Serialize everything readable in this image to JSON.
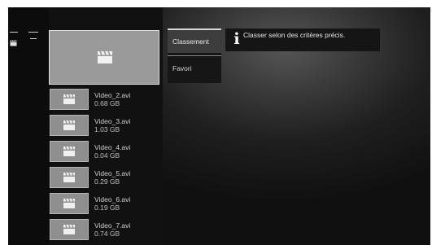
{
  "hero": {
    "icon": "clapperboard-icon"
  },
  "videos": [
    {
      "name": "Video_2.avi",
      "size": "0.68 GB",
      "icon": "clapperboard-icon"
    },
    {
      "name": "Video_3.avi",
      "size": "1.03 GB",
      "icon": "clapperboard-icon"
    },
    {
      "name": "Video_4.avi",
      "size": "0.04 GB",
      "icon": "clapperboard-icon"
    },
    {
      "name": "Video_5.avi",
      "size": "0.29 GB",
      "icon": "clapperboard-icon"
    },
    {
      "name": "Video_6.avi",
      "size": "0.19 GB",
      "icon": "clapperboard-icon"
    },
    {
      "name": "Video_7.avi",
      "size": "0.74 GB",
      "icon": "clapperboard-icon"
    }
  ],
  "menu": {
    "items": [
      {
        "label": "Classement",
        "selected": true
      },
      {
        "label": "Favori",
        "selected": false
      }
    ]
  },
  "info": {
    "icon": "info-icon",
    "text": "Classer selon des critères précis."
  }
}
